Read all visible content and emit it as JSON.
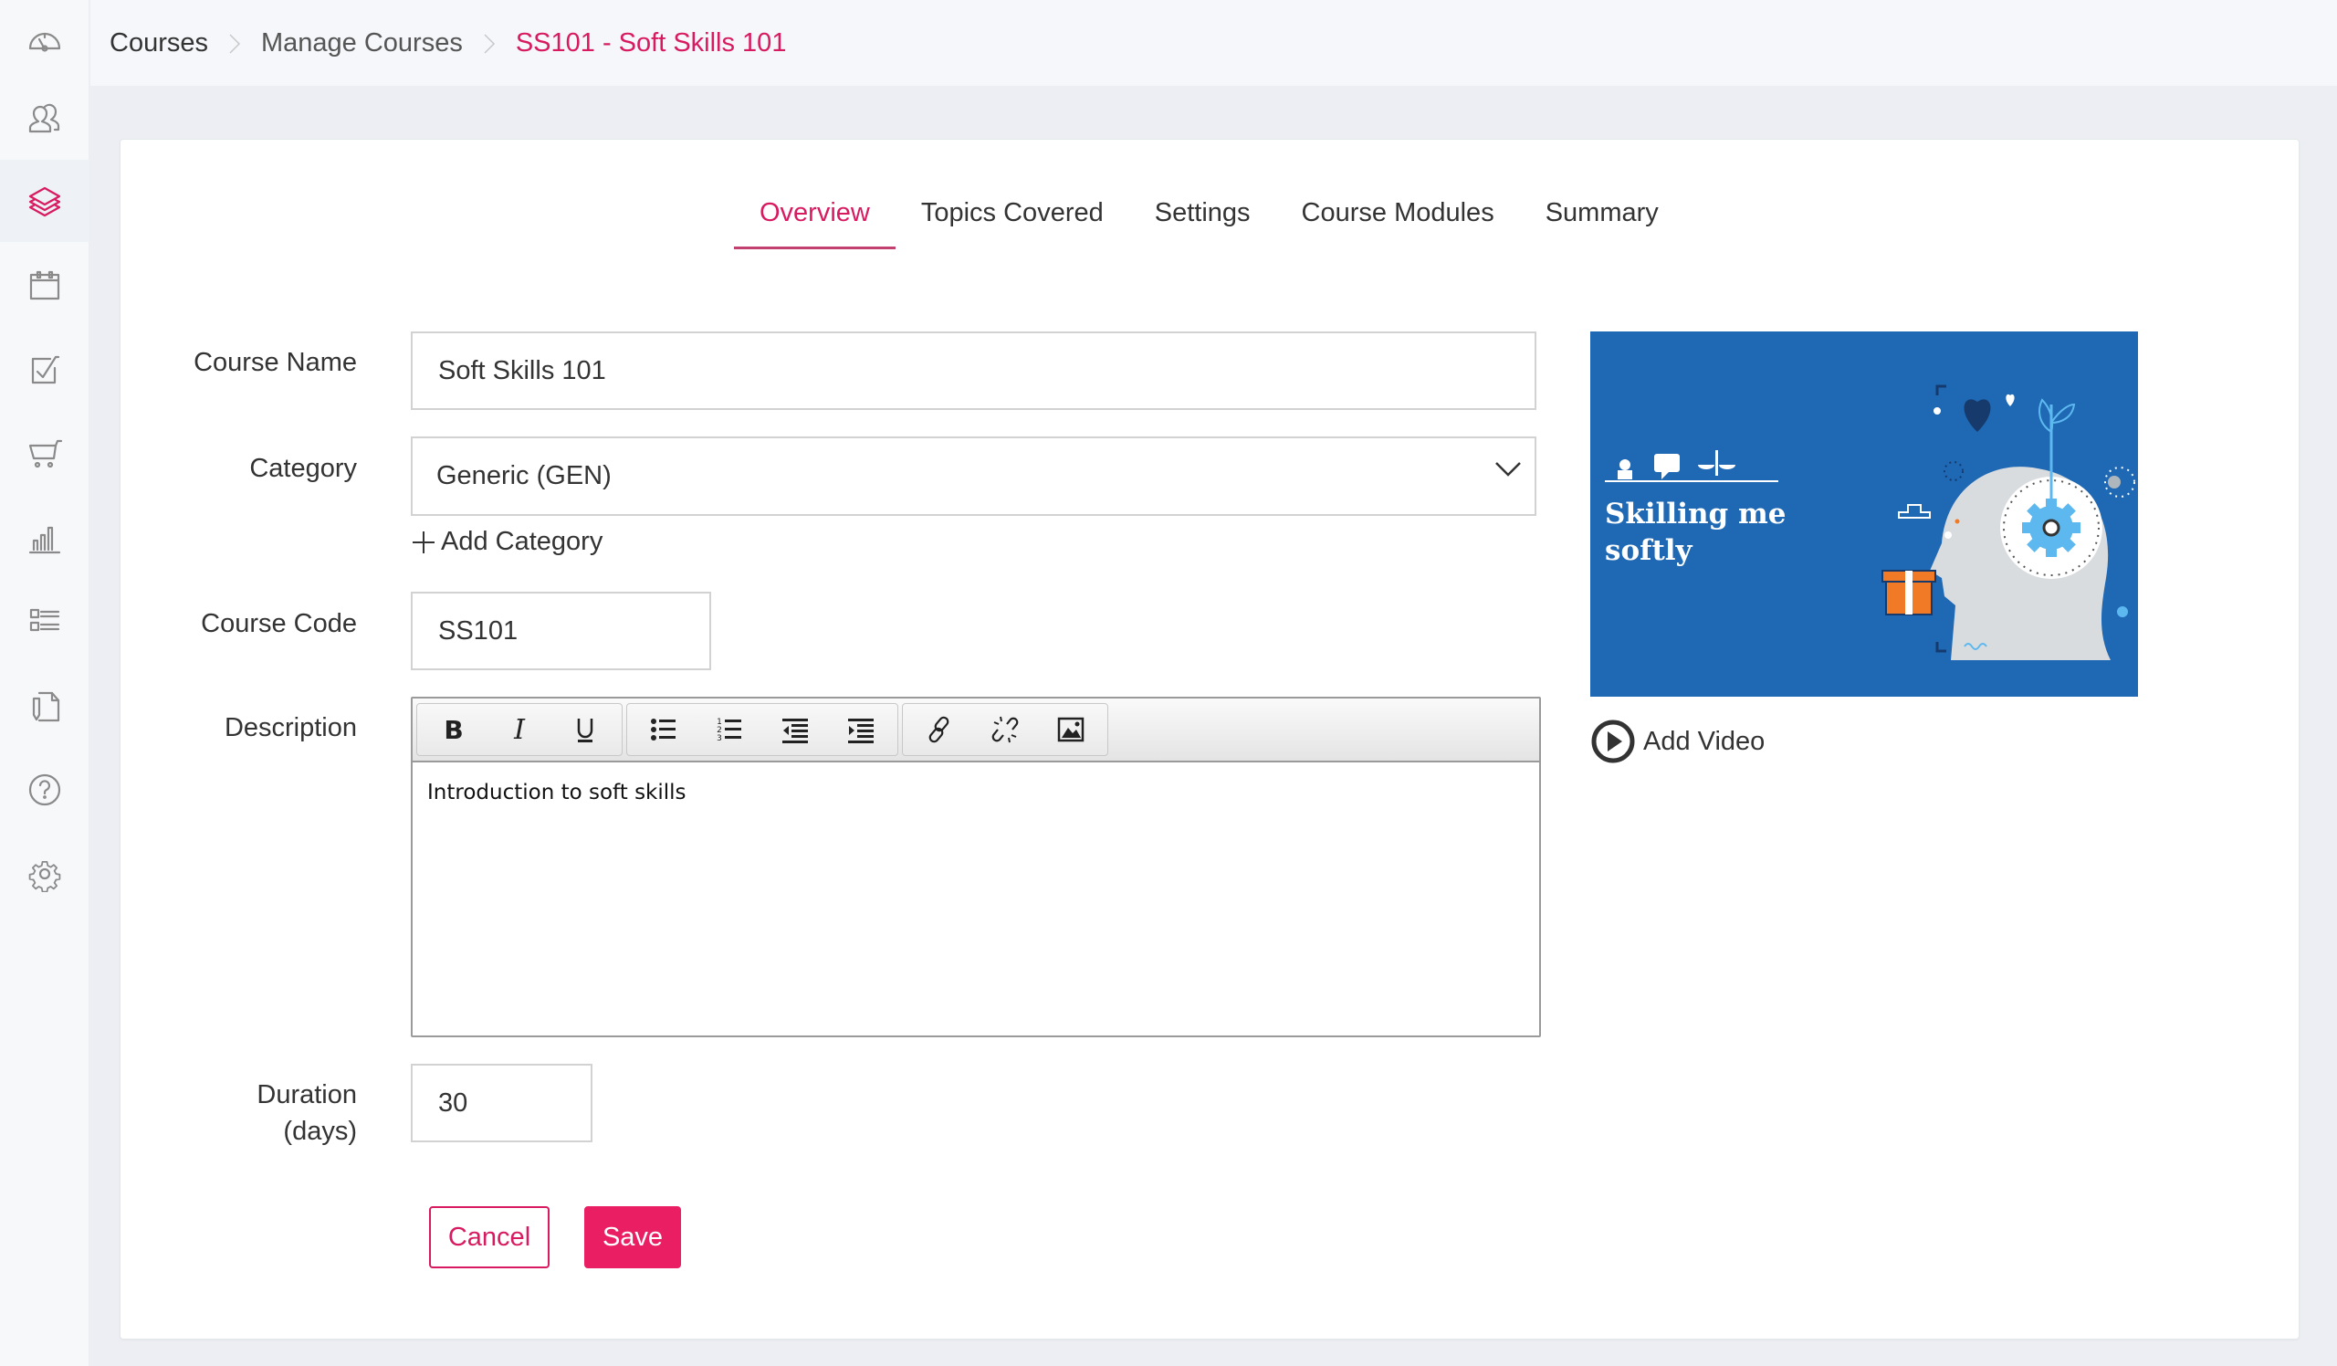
{
  "sidebar": {
    "items": [
      {
        "name": "dashboard",
        "icon": "dashboard-gauge-icon",
        "active": false
      },
      {
        "name": "users",
        "icon": "users-icon",
        "active": false
      },
      {
        "name": "courses",
        "icon": "layers-icon",
        "active": true
      },
      {
        "name": "calendar",
        "icon": "calendar-icon",
        "active": false
      },
      {
        "name": "assessments",
        "icon": "checkbox-icon",
        "active": false
      },
      {
        "name": "store",
        "icon": "cart-icon",
        "active": false
      },
      {
        "name": "reports",
        "icon": "bar-chart-icon",
        "active": false
      },
      {
        "name": "lists",
        "icon": "list-icon",
        "active": false
      },
      {
        "name": "documents",
        "icon": "document-edit-icon",
        "active": false
      },
      {
        "name": "help",
        "icon": "help-icon",
        "active": false
      },
      {
        "name": "settings",
        "icon": "gear-icon",
        "active": false
      }
    ]
  },
  "breadcrumb": {
    "items": [
      "Courses",
      "Manage Courses",
      "SS101 - Soft Skills 101"
    ]
  },
  "tabs": [
    {
      "label": "Overview",
      "active": true
    },
    {
      "label": "Topics Covered",
      "active": false
    },
    {
      "label": "Settings",
      "active": false
    },
    {
      "label": "Course Modules",
      "active": false
    },
    {
      "label": "Summary",
      "active": false
    }
  ],
  "form": {
    "course_name": {
      "label": "Course Name",
      "value": "Soft Skills 101"
    },
    "category": {
      "label": "Category",
      "value": "Generic (GEN)",
      "add_label": "Add Category"
    },
    "course_code": {
      "label": "Course Code",
      "value": "SS101"
    },
    "description": {
      "label": "Description",
      "value": "Introduction  to soft skills",
      "toolbar": [
        "bold",
        "italic",
        "underline",
        "bulleted-list",
        "numbered-list",
        "outdent",
        "indent",
        "link",
        "unlink",
        "image"
      ]
    },
    "duration": {
      "label_line1": "Duration",
      "label_line2": "(days)",
      "value": "30"
    },
    "cancel_label": "Cancel",
    "save_label": "Save"
  },
  "media": {
    "thumbnail_title": "Skilling me softly",
    "add_video_label": "Add Video"
  },
  "colors": {
    "accent": "#d81b60",
    "save_button": "#e91e63",
    "thumbnail_bg": "#1f68b4"
  }
}
